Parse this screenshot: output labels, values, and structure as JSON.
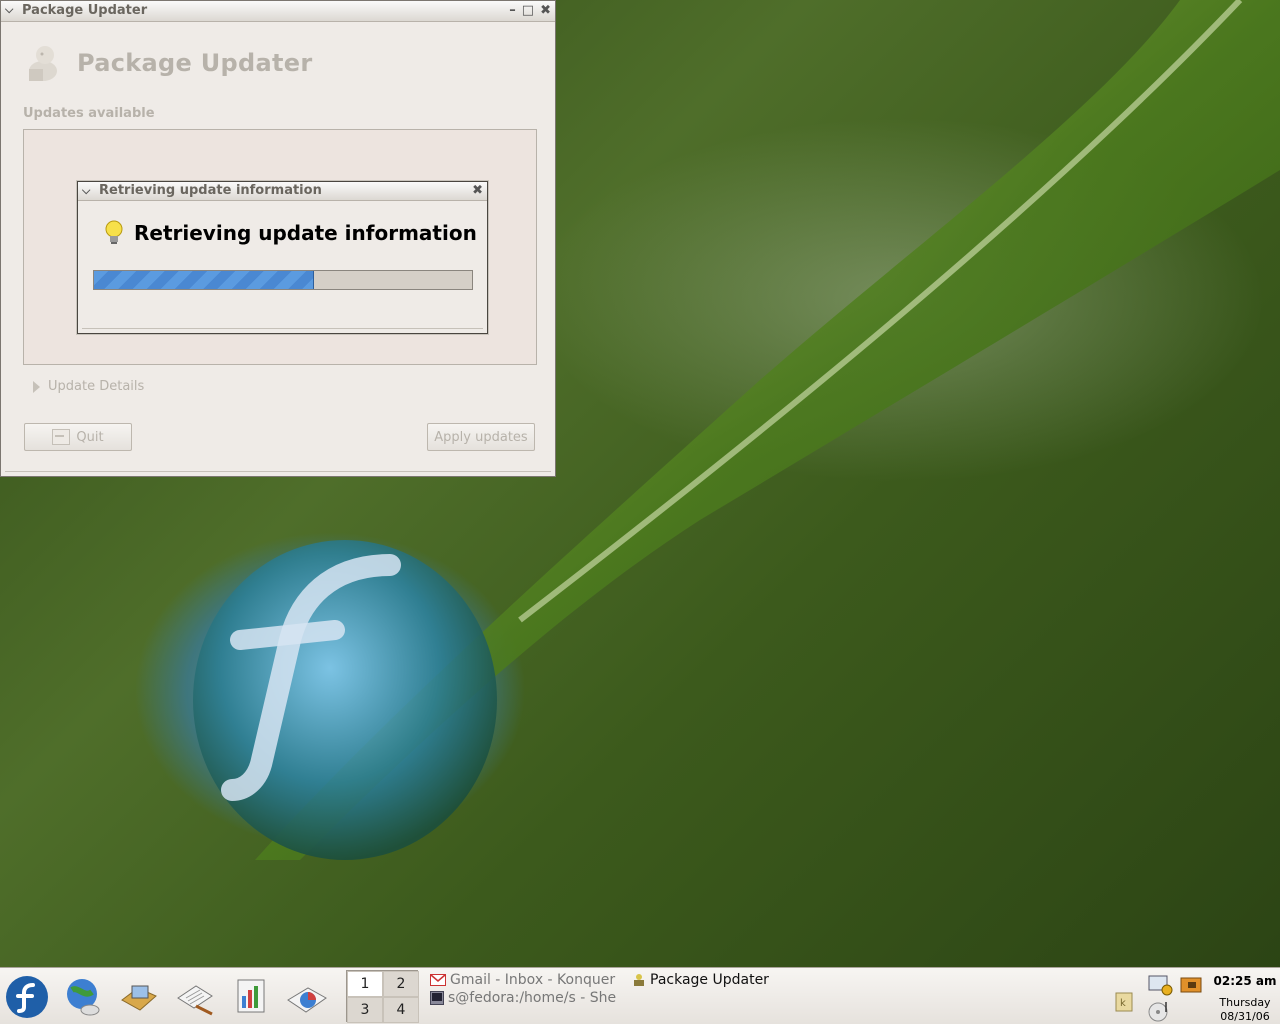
{
  "main_window": {
    "title": "Package Updater",
    "app_title": "Package Updater",
    "section_label": "Updates available",
    "details_label": "Update Details",
    "quit_label": "Quit",
    "apply_label": "Apply updates"
  },
  "dialog": {
    "title": "Retrieving update information",
    "heading": "Retrieving update information",
    "progress": 0.58
  },
  "panel": {
    "launchers": [
      "fedora-menu-icon",
      "web-browser-icon",
      "file-manager-icon",
      "text-editor-icon",
      "presentation-icon",
      "spreadsheet-icon"
    ],
    "pager": [
      "1",
      "2",
      "3",
      "4"
    ],
    "active_desktop": "1",
    "tasks": [
      {
        "name": "Gmail - Inbox - Konquer",
        "icon": "gmail-icon"
      },
      {
        "name": "Package Updater",
        "icon": "package-updater-icon"
      },
      {
        "name": "s@fedora:/home/s - She",
        "icon": "terminal-icon"
      }
    ],
    "clock": {
      "time": "02:25 am",
      "day": "Thursday",
      "date": "08/31/06"
    }
  },
  "colors": {
    "progress": "#5b9be0",
    "panel_bg": "#efebe7",
    "disabled_text": "#b7b2aa"
  }
}
